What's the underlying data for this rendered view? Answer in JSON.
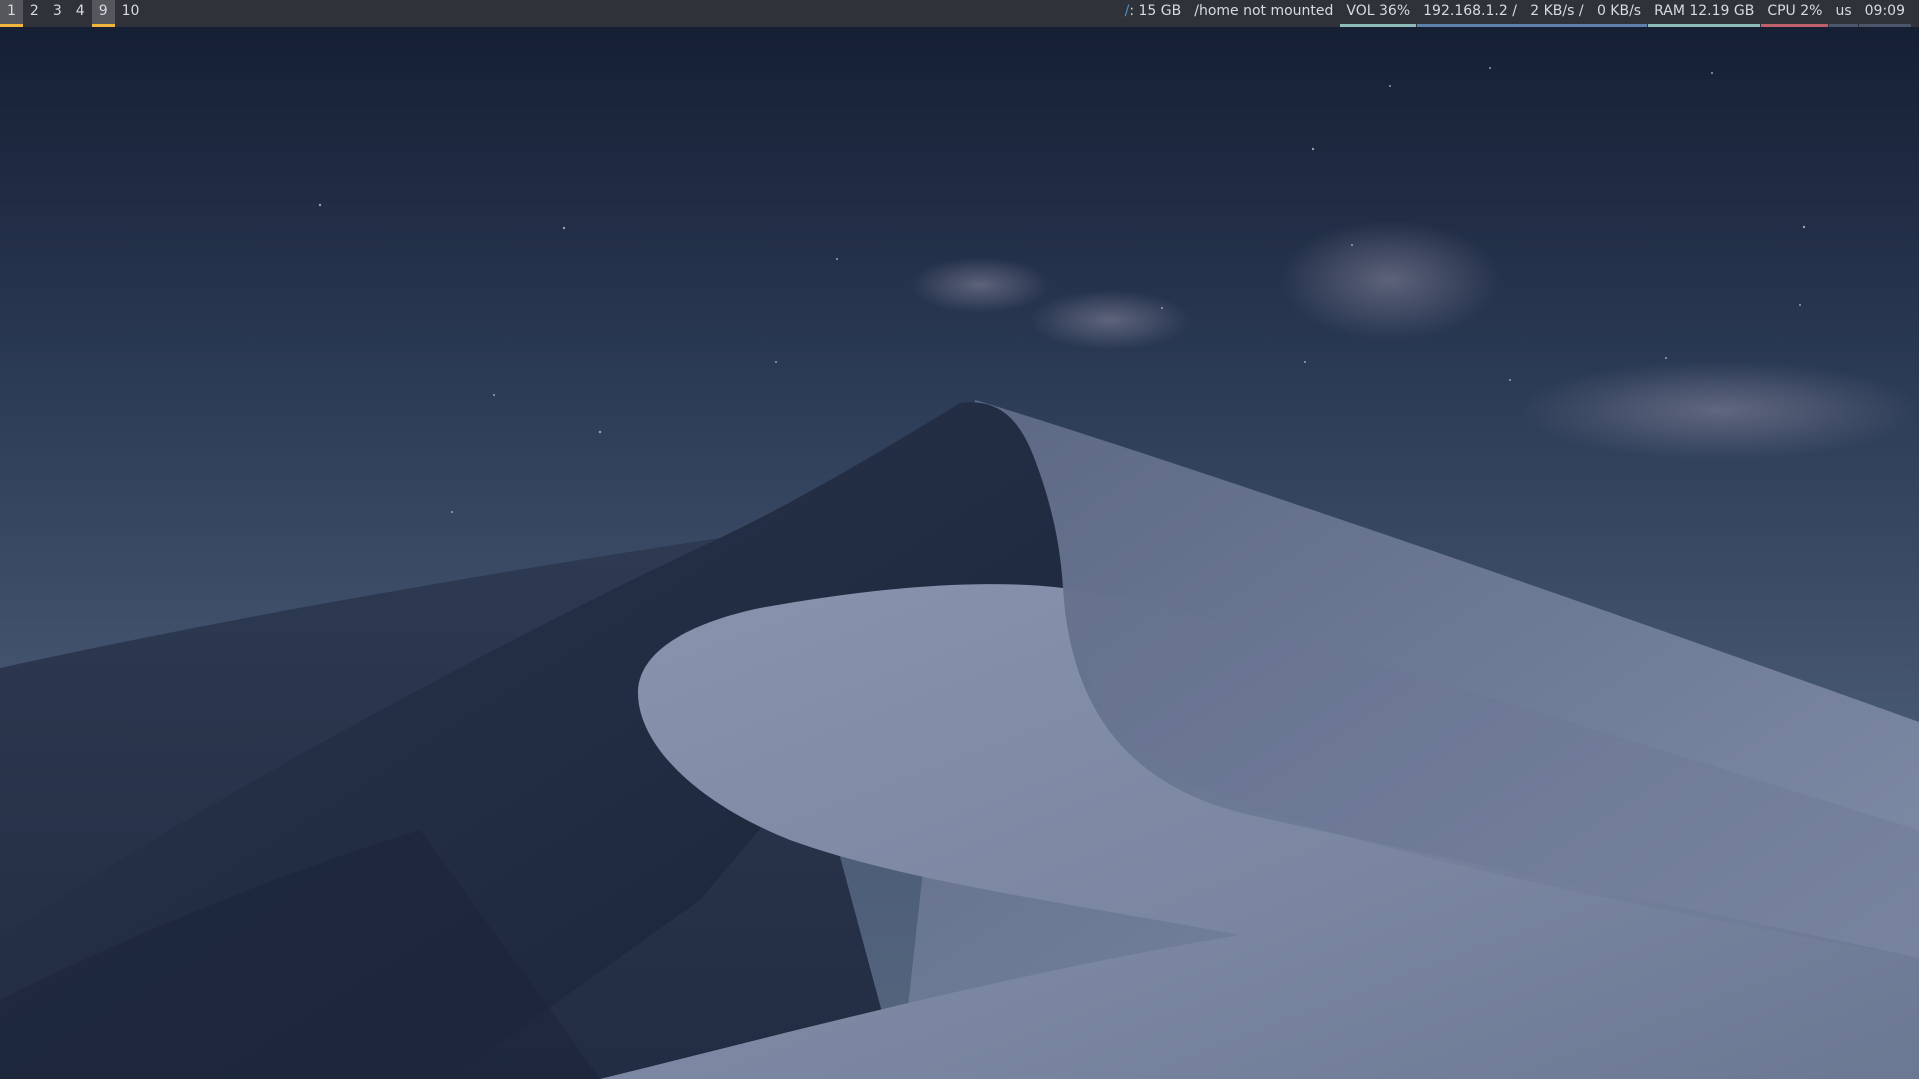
{
  "workspaces": [
    {
      "label": "1",
      "state": "focused"
    },
    {
      "label": "2",
      "state": "normal"
    },
    {
      "label": "3",
      "state": "normal"
    },
    {
      "label": "4",
      "state": "normal"
    },
    {
      "label": "9",
      "state": "urgent"
    },
    {
      "label": "10",
      "state": "normal"
    }
  ],
  "modules": {
    "disk_root": {
      "prefix": "/",
      "text": ": 15 GB"
    },
    "disk_home": {
      "text": "/home not mounted"
    },
    "volume": {
      "text": "VOL 36%",
      "underline_color": "#8fbcbb"
    },
    "network": {
      "text": "192.168.1.2 /   2 KB/s /   0 KB/s",
      "underline_color": "#5e81ac"
    },
    "ram": {
      "text": "RAM 12.19 GB",
      "underline_color": "#8fbcbb"
    },
    "cpu": {
      "text": "CPU 2%",
      "underline_color": "#bf616a"
    },
    "keyboard": {
      "text": "us",
      "underline_color": "#4c566a"
    },
    "clock": {
      "text": "09:09",
      "underline_color": "#4c566a"
    }
  },
  "colors": {
    "bar_bg": "#2f3238",
    "focused_underline": "#f2b63c",
    "sky_top": "#141d30",
    "sky_bottom": "#4c5d78",
    "dune_light": "#7d89a3",
    "dune_dark": "#1d273b"
  }
}
